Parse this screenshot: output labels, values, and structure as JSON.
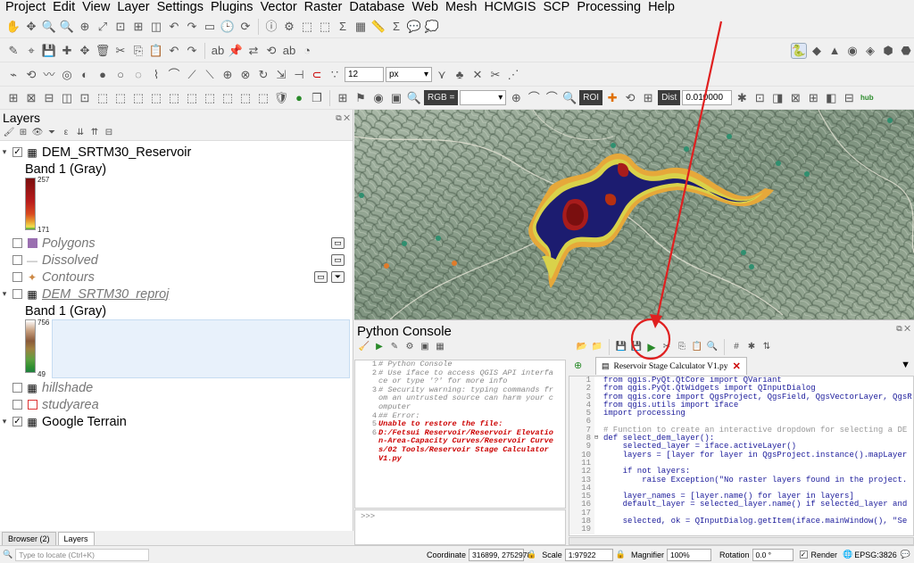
{
  "menu": [
    "Project",
    "Edit",
    "View",
    "Layer",
    "Settings",
    "Plugins",
    "Vector",
    "Raster",
    "Database",
    "Web",
    "Mesh",
    "HCMGIS",
    "SCP",
    "Processing",
    "Help"
  ],
  "toolbar": {
    "snap_tolerance": "12",
    "snap_units": "px",
    "scp_rgb_label": "RGB =",
    "scp_rgb_value": "",
    "scp_roi_label": "ROI",
    "scp_dist_label": "Dist",
    "scp_dist_value": "0.010000",
    "hub_label": "hub"
  },
  "layers": {
    "title": "Layers",
    "items": [
      {
        "name": "DEM_SRTM30_Reservoir",
        "checked": true,
        "expanded": true,
        "sub": "Band 1 (Gray)",
        "max": "257",
        "min": "171"
      },
      {
        "name": "Polygons",
        "checked": false
      },
      {
        "name": "Dissolved",
        "checked": false
      },
      {
        "name": "Contours",
        "checked": false
      },
      {
        "name": "DEM_SRTM30_reproj",
        "checked": false,
        "expanded": true,
        "sub": "Band 1 (Gray)",
        "max": "756",
        "min": "49"
      },
      {
        "name": "hillshade",
        "checked": false
      },
      {
        "name": "studyarea",
        "checked": false
      },
      {
        "name": "Google Terrain",
        "checked": true
      }
    ]
  },
  "bottom_tabs": [
    "Browser (2)",
    "Layers"
  ],
  "python_console": {
    "title": "Python Console",
    "output_lines": [
      {
        "n": "1",
        "t": "# Python Console",
        "err": false
      },
      {
        "n": "2",
        "t": "# Use iface to access QGIS API interfa",
        "err": false
      },
      {
        "n": "",
        "t": "ce or type '?' for more info",
        "err": false
      },
      {
        "n": "3",
        "t": "# Security warning: typing commands fr",
        "err": false
      },
      {
        "n": "",
        "t": "om an untrusted source can harm your c",
        "err": false
      },
      {
        "n": "",
        "t": "omputer",
        "err": false
      },
      {
        "n": "4",
        "t": "## Error:",
        "err": false
      },
      {
        "n": "5",
        "t": "Unable to restore the file:",
        "err": true
      },
      {
        "n": "6",
        "t": "D:/Fetsui Reservoir/Reservoir Elevatio",
        "err": true
      },
      {
        "n": "",
        "t": "n-Area-Capacity Curves/Reservoir Curve",
        "err": true
      },
      {
        "n": "",
        "t": "s/02 Tools/Reservoir Stage Calculator",
        "err": true
      },
      {
        "n": "",
        "t": "V1.py",
        "err": true
      }
    ],
    "prompt": ">>>",
    "editor_tab": "Reservoir Stage Calculator V1.py",
    "code_lines": [
      {
        "n": "1",
        "t": "from qgis.PyQt.QtCore import QVariant"
      },
      {
        "n": "2",
        "t": "from qgis.PyQt.QtWidgets import QInputDialog"
      },
      {
        "n": "3",
        "t": "from qgis.core import QgsProject, QgsField, QgsVectorLayer, QgsR"
      },
      {
        "n": "4",
        "t": "from qgis.utils import iface"
      },
      {
        "n": "5",
        "t": "import processing"
      },
      {
        "n": "6",
        "t": ""
      },
      {
        "n": "7",
        "t": "# Function to create an interactive dropdown for selecting a DE"
      },
      {
        "n": "8",
        "t": "def select_dem_layer():"
      },
      {
        "n": "9",
        "t": "    selected_layer = iface.activeLayer()"
      },
      {
        "n": "10",
        "t": "    layers = [layer for layer in QgsProject.instance().mapLayer"
      },
      {
        "n": "11",
        "t": ""
      },
      {
        "n": "12",
        "t": "    if not layers:"
      },
      {
        "n": "13",
        "t": "        raise Exception(\"No raster layers found in the project."
      },
      {
        "n": "14",
        "t": ""
      },
      {
        "n": "15",
        "t": "    layer_names = [layer.name() for layer in layers]"
      },
      {
        "n": "16",
        "t": "    default_layer = selected_layer.name() if selected_layer and"
      },
      {
        "n": "17",
        "t": ""
      },
      {
        "n": "18",
        "t": "    selected, ok = QInputDialog.getItem(iface.mainWindow(), \"Se"
      },
      {
        "n": "19",
        "t": ""
      }
    ]
  },
  "status": {
    "locate_placeholder": "Type to locate (Ctrl+K)",
    "coordinate_label": "Coordinate",
    "coordinate": "316899, 2752978",
    "scale_label": "Scale",
    "scale": "1:97922",
    "magnifier_label": "Magnifier",
    "magnifier": "100%",
    "rotation_label": "Rotation",
    "rotation": "0.0 °",
    "render_label": "Render",
    "crs": "EPSG:3826"
  },
  "colors": {
    "accent_red": "#e02020",
    "water": "#1a1a6a"
  }
}
